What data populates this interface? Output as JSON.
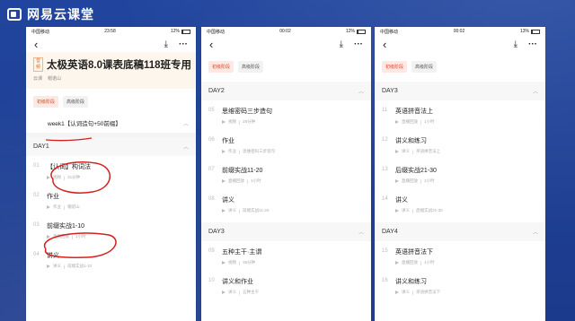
{
  "brand": {
    "name": "网易云课堂",
    "logo_icon": "netease-cloud-classroom-logo-icon"
  },
  "annotation_color": "#d42020",
  "phones": [
    {
      "status": {
        "carrier": "中国移动",
        "time": "23:58",
        "battery": "12%",
        "battery_level": 0.12
      },
      "course": {
        "tag": "音频",
        "title": "太极英语8.0课表底稿118班专用",
        "meta_a": "云课",
        "meta_b": "帽诺山"
      },
      "tabs": [
        "初级阶段",
        "高级阶段"
      ],
      "week": "week1【认词造句+50前缀】",
      "day1": "DAY1",
      "lessons": [
        {
          "no": "01",
          "title": "【认词】构词法",
          "meta_a": "视频",
          "meta_b": "31分钟"
        },
        {
          "no": "02",
          "title": "作业",
          "meta_a": "作业",
          "meta_b": "帽诺山"
        },
        {
          "no": "03",
          "title": "前缀实战1-10",
          "meta_a": "直播回放",
          "meta_b": "1小时"
        },
        {
          "no": "04",
          "title": "讲义",
          "meta_a": "讲义",
          "meta_b": "前缀实战1-10"
        }
      ]
    },
    {
      "status": {
        "carrier": "中国移动",
        "time": "00:02",
        "battery": "12%",
        "battery_level": 0.12
      },
      "tabs": [
        "初级阶段",
        "高级阶段"
      ],
      "day2": "DAY2",
      "day2_lessons": [
        {
          "no": "05",
          "title": "思维密码三步造句",
          "meta_a": "视频",
          "meta_b": "28分钟"
        },
        {
          "no": "06",
          "title": "作业",
          "meta_a": "作业",
          "meta_b": "思维密码三步造句"
        },
        {
          "no": "07",
          "title": "前缀实战11-20",
          "meta_a": "直播回放",
          "meta_b": "1小时"
        },
        {
          "no": "08",
          "title": "讲义",
          "meta_a": "讲义",
          "meta_b": "前缀实战11-20"
        }
      ],
      "day3": "DAY3",
      "day3_lessons": [
        {
          "no": "09",
          "title": "五种主干·主谓",
          "meta_a": "视频",
          "meta_b": "35分钟"
        },
        {
          "no": "10",
          "title": "讲义和作业",
          "meta_a": "讲义",
          "meta_b": "五种主干"
        }
      ]
    },
    {
      "status": {
        "carrier": "中国移动",
        "time": "00:02",
        "battery": "13%",
        "battery_level": 0.13
      },
      "tabs": [
        "初级阶段",
        "高级阶段"
      ],
      "day3": "DAY3",
      "day3_lessons": [
        {
          "no": "11",
          "title": "英语拼音法上",
          "meta_a": "直播回放",
          "meta_b": "1小时"
        },
        {
          "no": "12",
          "title": "讲义和练习",
          "meta_a": "讲义",
          "meta_b": "英语拼音法上"
        },
        {
          "no": "13",
          "title": "后缀实战21-30",
          "meta_a": "直播回放",
          "meta_b": "1小时"
        },
        {
          "no": "14",
          "title": "讲义",
          "meta_a": "讲义",
          "meta_b": "后缀实战21-30"
        }
      ],
      "day4": "DAY4",
      "day4_lessons": [
        {
          "no": "15",
          "title": "英语拼音法下",
          "meta_a": "直播回放",
          "meta_b": "1小时"
        },
        {
          "no": "16",
          "title": "讲义和练习",
          "meta_a": "讲义",
          "meta_b": "英语拼音法下"
        }
      ]
    }
  ]
}
